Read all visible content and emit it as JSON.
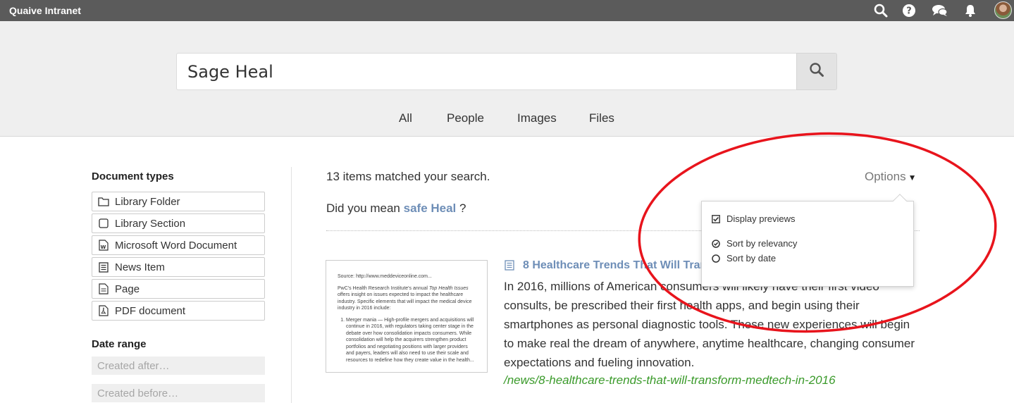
{
  "app": {
    "title": "Quaive Intranet"
  },
  "topbar": {
    "icons": [
      "search-icon",
      "help-icon",
      "chat-icon",
      "bell-icon"
    ],
    "avatar": "user-avatar"
  },
  "search": {
    "value": "Sage Heal",
    "button_icon": "search-icon"
  },
  "tabs": [
    "All",
    "People",
    "Images",
    "Files"
  ],
  "sidebar": {
    "document_types_heading": "Document types",
    "document_types": [
      {
        "label": "Library Folder",
        "icon": "folder-icon"
      },
      {
        "label": "Library Section",
        "icon": "square-icon"
      },
      {
        "label": "Microsoft Word Document",
        "icon": "word-icon"
      },
      {
        "label": "News Item",
        "icon": "news-icon"
      },
      {
        "label": "Page",
        "icon": "page-icon"
      },
      {
        "label": "PDF document",
        "icon": "pdf-icon"
      }
    ],
    "date_range_heading": "Date range",
    "created_after_placeholder": "Created after…",
    "created_before_placeholder": "Created before…"
  },
  "results": {
    "count_text": "13 items matched your search.",
    "did_you_mean_prefix": "Did you mean",
    "did_you_mean_suggestion": "safe Heal",
    "did_you_mean_suffix": "?",
    "options_label": "Options",
    "items": [
      {
        "title": "8 Healthcare Trends That Will Transform MedTech in 2016",
        "icon": "news-icon",
        "snippet": "In 2016, millions of American consumers will likely have their first video consults, be prescribed their first health apps, and begin using their smartphones as personal diagnostic tools. These new experiences will begin to make real the dream of anywhere, anytime healthcare, changing consumer expectations and fueling innovation.",
        "url": "/news/8-healthcare-trends-that-will-transform-medtech-in-2016",
        "preview": {
          "source": "Source: http://www.meddeviceonline.com...",
          "intro_before": "PwC's Health Research Institute's annual ",
          "intro_italic": "Top Health Issues",
          "intro_after": " offers insight on issues expected to impact the healthcare industry. Specific elements that will impact the medical device industry in 2016 include:",
          "list_item": "Merger mania — High-profile mergers and acquisitions will continue in 2016, with regulators taking center stage in the debate over how consolidation impacts consumers. While consolidation will help the acquirers strengthen product portfolios and negotiating positions with larger providers and payers, leaders will also need to use their scale and resources to redefine how they create value in the health..."
        }
      }
    ]
  },
  "options_menu": {
    "display_previews": {
      "label": "Display previews",
      "checked": true
    },
    "sort_by_relevancy": {
      "label": "Sort by relevancy",
      "selected": true
    },
    "sort_by_date": {
      "label": "Sort by date",
      "selected": false
    }
  },
  "colors": {
    "topbar": "#5b5b5b",
    "link": "#6e8eb7",
    "url": "#3a9a2a",
    "annotation": "#e8141c"
  }
}
